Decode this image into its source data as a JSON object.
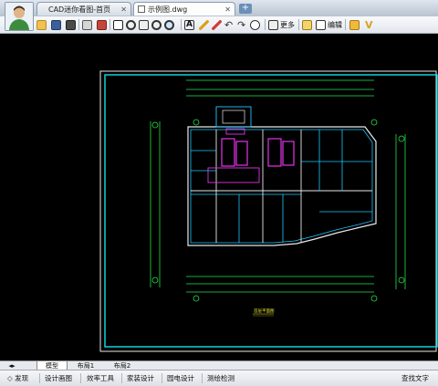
{
  "tabs": [
    {
      "label": "CAD迷你看图-首页"
    },
    {
      "label": "示例图.dwg"
    }
  ],
  "new_tab_label": "+",
  "toolbar": {
    "more_label": "更多",
    "edit_label": "编辑"
  },
  "drawing": {
    "title": "首层平面图"
  },
  "layout_tabs": [
    {
      "label": "模型"
    },
    {
      "label": "布局1"
    },
    {
      "label": "布局2"
    }
  ],
  "statusbar": {
    "items": [
      {
        "label": "发现"
      },
      {
        "label": "设计画图"
      },
      {
        "label": "效率工具"
      },
      {
        "label": "家装设计"
      },
      {
        "label": "园电设计"
      },
      {
        "label": "测绘检测"
      }
    ],
    "search_label": "查找文字"
  },
  "colors": {
    "drawing_border": "#12e0e8",
    "wall": "#e8e8e8",
    "axis": "#24e34a",
    "partition": "#1ec9ff",
    "equipment": "#e334e9",
    "dimension": "#e8e83a"
  }
}
